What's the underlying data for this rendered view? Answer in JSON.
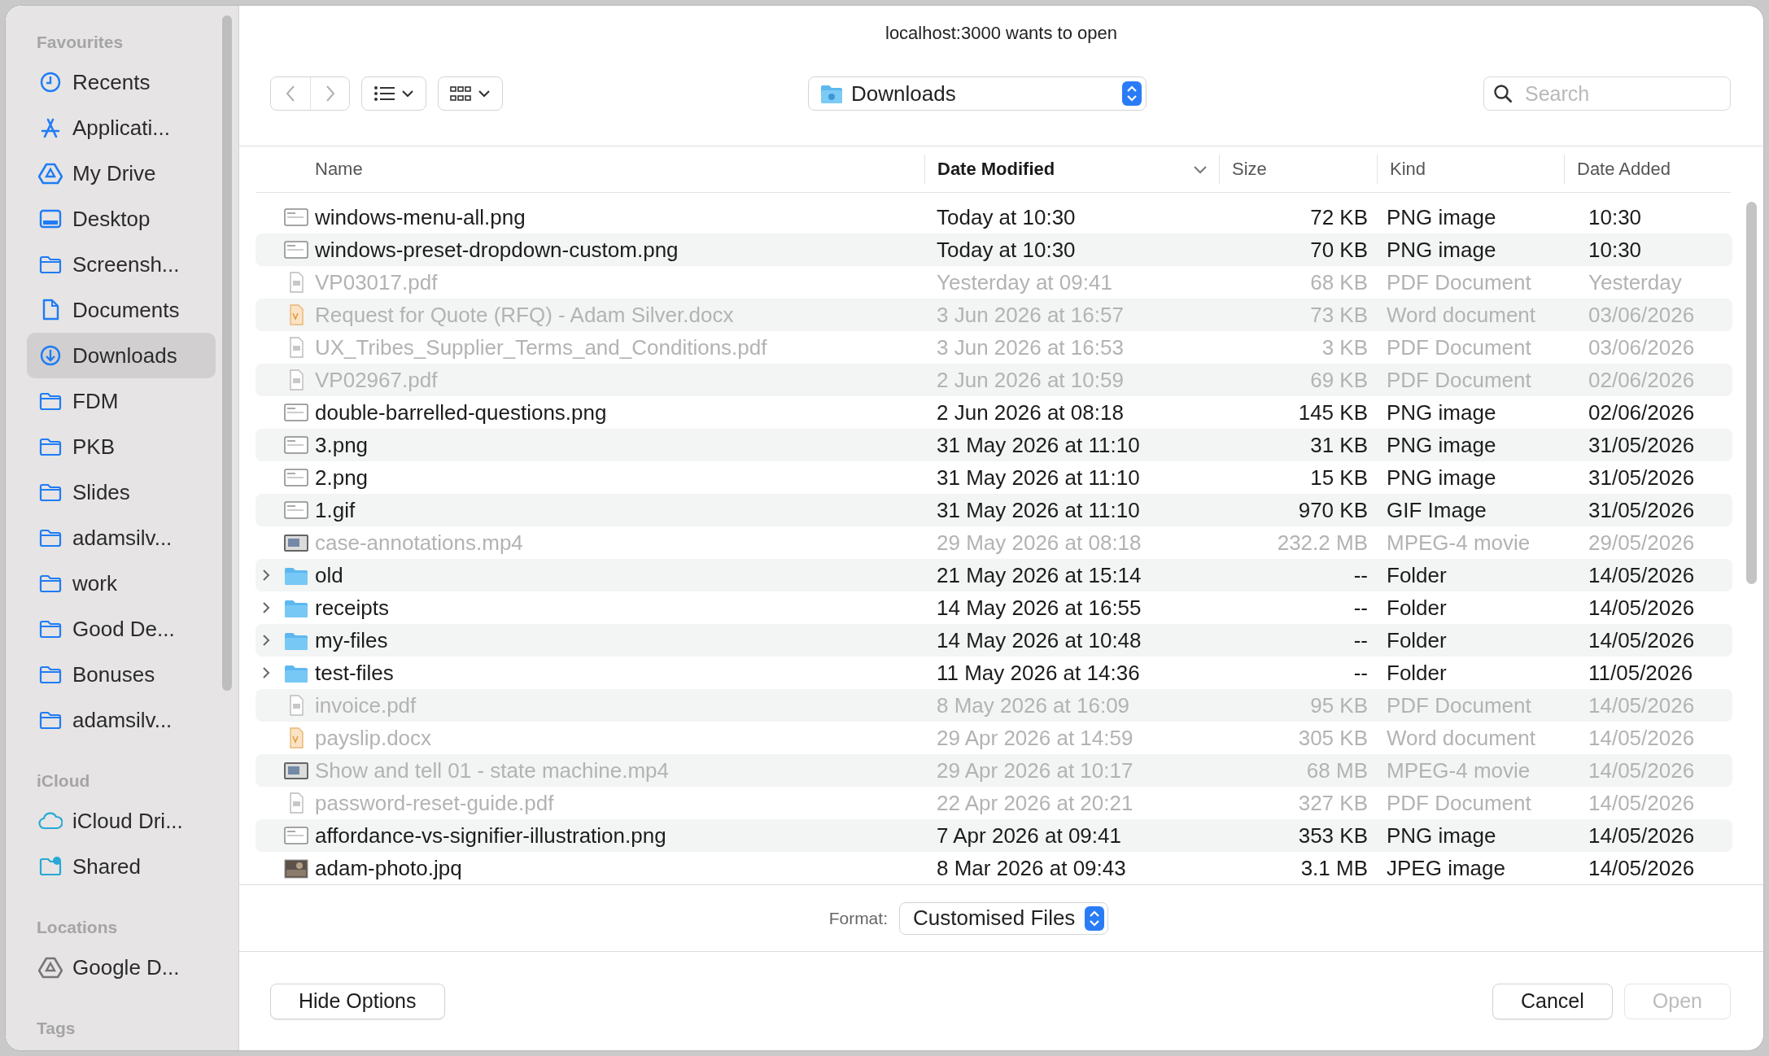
{
  "dialog": {
    "title": "localhost:3000 wants to open"
  },
  "sidebar": [
    {
      "heading": "Favourites",
      "items": [
        {
          "label": "Recents",
          "kind": "clock",
          "selected": false
        },
        {
          "label": "Applicati...",
          "kind": "apps",
          "selected": false
        },
        {
          "label": "My Drive",
          "kind": "drive",
          "selected": false
        },
        {
          "label": "Desktop",
          "kind": "desktop",
          "selected": false
        },
        {
          "label": "Screensh...",
          "kind": "folder",
          "selected": false
        },
        {
          "label": "Documents",
          "kind": "document",
          "selected": false
        },
        {
          "label": "Downloads",
          "kind": "download",
          "selected": true
        },
        {
          "label": "FDM",
          "kind": "folder",
          "selected": false
        },
        {
          "label": "PKB",
          "kind": "folder",
          "selected": false
        },
        {
          "label": "Slides",
          "kind": "folder",
          "selected": false
        },
        {
          "label": "adamsilv...",
          "kind": "folder",
          "selected": false
        },
        {
          "label": "work",
          "kind": "folder",
          "selected": false
        },
        {
          "label": "Good De...",
          "kind": "folder",
          "selected": false
        },
        {
          "label": "Bonuses",
          "kind": "folder",
          "selected": false
        },
        {
          "label": "adamsilv...",
          "kind": "folder",
          "selected": false
        }
      ]
    },
    {
      "heading": "iCloud",
      "items": [
        {
          "label": "iCloud Dri...",
          "kind": "cloud",
          "selected": false
        },
        {
          "label": "Shared",
          "kind": "shared",
          "selected": false
        }
      ]
    },
    {
      "heading": "Locations",
      "items": [
        {
          "label": "Google D...",
          "kind": "gdrive",
          "selected": false
        }
      ]
    },
    {
      "heading": "Tags"
    }
  ],
  "toolbar": {
    "location": "Downloads",
    "search": {
      "placeholder": "Search"
    }
  },
  "columns": [
    {
      "label": "Name",
      "sorted": false
    },
    {
      "label": "Date Modified",
      "sorted": true
    },
    {
      "label": "Size",
      "sorted": false
    },
    {
      "label": "Kind",
      "sorted": false
    },
    {
      "label": "Date Added",
      "sorted": false
    }
  ],
  "files": [
    {
      "name": "windows-menu-all.png",
      "date_modified": "Today at 10:30",
      "size": "72 KB",
      "kind_label": "PNG image",
      "date_added": "10:30",
      "kind": "image",
      "disabled": false
    },
    {
      "name": "windows-preset-dropdown-custom.png",
      "date_modified": "Today at 10:30",
      "size": "70 KB",
      "kind_label": "PNG image",
      "date_added": "10:30",
      "kind": "image",
      "disabled": false
    },
    {
      "name": "VP03017.pdf",
      "date_modified": "Yesterday at 09:41",
      "size": "68 KB",
      "kind_label": "PDF Document",
      "date_added": "Yesterday",
      "kind": "pdf",
      "disabled": true
    },
    {
      "name": "Request for Quote (RFQ) - Adam Silver.docx",
      "date_modified": "3 Jun 2026 at 16:57",
      "size": "73 KB",
      "kind_label": "Word document",
      "date_added": "03/06/2026",
      "kind": "word",
      "disabled": true
    },
    {
      "name": "UX_Tribes_Supplier_Terms_and_Conditions.pdf",
      "date_modified": "3 Jun 2026 at 16:53",
      "size": "3 KB",
      "kind_label": "PDF Document",
      "date_added": "03/06/2026",
      "kind": "pdf",
      "disabled": true
    },
    {
      "name": "VP02967.pdf",
      "date_modified": "2 Jun 2026 at 10:59",
      "size": "69 KB",
      "kind_label": "PDF Document",
      "date_added": "02/06/2026",
      "kind": "pdf",
      "disabled": true
    },
    {
      "name": "double-barrelled-questions.png",
      "date_modified": "2 Jun 2026 at 08:18",
      "size": "145 KB",
      "kind_label": "PNG image",
      "date_added": "02/06/2026",
      "kind": "image",
      "disabled": false
    },
    {
      "name": "3.png",
      "date_modified": "31 May 2026 at 11:10",
      "size": "31 KB",
      "kind_label": "PNG image",
      "date_added": "31/05/2026",
      "kind": "image",
      "disabled": false
    },
    {
      "name": "2.png",
      "date_modified": "31 May 2026 at 11:10",
      "size": "15 KB",
      "kind_label": "PNG image",
      "date_added": "31/05/2026",
      "kind": "image",
      "disabled": false
    },
    {
      "name": "1.gif",
      "date_modified": "31 May 2026 at 11:10",
      "size": "970 KB",
      "kind_label": "GIF Image",
      "date_added": "31/05/2026",
      "kind": "image",
      "disabled": false
    },
    {
      "name": "case-annotations.mp4",
      "date_modified": "29 May 2026 at 08:18",
      "size": "232.2 MB",
      "kind_label": "MPEG-4 movie",
      "date_added": "29/05/2026",
      "kind": "video",
      "disabled": true
    },
    {
      "name": "old",
      "date_modified": "21 May 2026 at 15:14",
      "size": "--",
      "kind_label": "Folder",
      "date_added": "14/05/2026",
      "kind": "folder",
      "disabled": false,
      "expanded": false
    },
    {
      "name": "receipts",
      "date_modified": "14 May 2026 at 16:55",
      "size": "--",
      "kind_label": "Folder",
      "date_added": "14/05/2026",
      "kind": "folder",
      "disabled": false,
      "expanded": false
    },
    {
      "name": "my-files",
      "date_modified": "14 May 2026 at 10:48",
      "size": "--",
      "kind_label": "Folder",
      "date_added": "14/05/2026",
      "kind": "folder",
      "disabled": false,
      "expanded": false
    },
    {
      "name": "test-files",
      "date_modified": "11 May 2026 at 14:36",
      "size": "--",
      "kind_label": "Folder",
      "date_added": "11/05/2026",
      "kind": "folder",
      "disabled": false,
      "expanded": false
    },
    {
      "name": "invoice.pdf",
      "date_modified": "8 May 2026 at 16:09",
      "size": "95 KB",
      "kind_label": "PDF Document",
      "date_added": "14/05/2026",
      "kind": "pdf",
      "disabled": true
    },
    {
      "name": "payslip.docx",
      "date_modified": "29 Apr 2026 at 14:59",
      "size": "305 KB",
      "kind_label": "Word document",
      "date_added": "14/05/2026",
      "kind": "word",
      "disabled": true
    },
    {
      "name": "Show and tell 01 - state machine.mp4",
      "date_modified": "29 Apr 2026 at 10:17",
      "size": "68 MB",
      "kind_label": "MPEG-4 movie",
      "date_added": "14/05/2026",
      "kind": "video",
      "disabled": true
    },
    {
      "name": "password-reset-guide.pdf",
      "date_modified": "22 Apr 2026 at 20:21",
      "size": "327 KB",
      "kind_label": "PDF Document",
      "date_added": "14/05/2026",
      "kind": "pdf",
      "disabled": true
    },
    {
      "name": "affordance-vs-signifier-illustration.png",
      "date_modified": "7 Apr 2026 at 09:41",
      "size": "353 KB",
      "kind_label": "PNG image",
      "date_added": "14/05/2026",
      "kind": "image",
      "disabled": false
    },
    {
      "name": "adam-photo.jpq",
      "date_modified": "8 Mar 2026 at 09:43",
      "size": "3.1 MB",
      "kind_label": "JPEG image",
      "date_added": "14/05/2026",
      "kind": "photo",
      "disabled": false
    }
  ],
  "format": {
    "label": "Format:",
    "value": "Customised Files"
  },
  "buttons": [
    {
      "label": "Hide Options",
      "disabled": false
    },
    {
      "label": "Cancel",
      "disabled": false
    },
    {
      "label": "Open",
      "disabled": true
    }
  ]
}
